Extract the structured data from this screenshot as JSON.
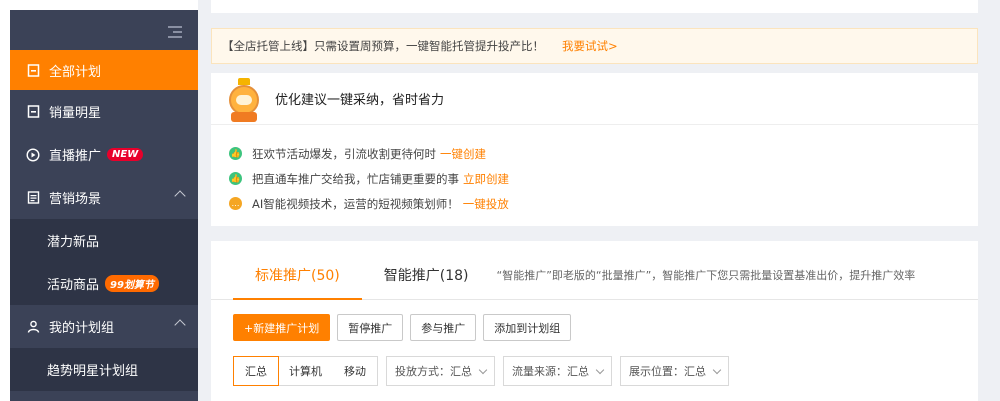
{
  "sidebar": {
    "items": [
      {
        "label": "全部计划",
        "icon": "bookmark-icon",
        "active": true
      },
      {
        "label": "销量明星",
        "icon": "bookmark-icon"
      },
      {
        "label": "直播推广",
        "icon": "play-circle-icon",
        "badge": "NEW"
      },
      {
        "label": "营销场景",
        "icon": "document-icon",
        "expanded": true
      },
      {
        "label": "我的计划组",
        "icon": "user-icon",
        "expanded": true
      }
    ],
    "sub_items": [
      {
        "label": "潜力新品"
      },
      {
        "label": "活动商品",
        "badge": "99划算节"
      },
      {
        "label": "趋势明星计划组"
      }
    ]
  },
  "notice": {
    "text": "【全店托管上线】只需设置周预算，一键智能托管提升投产比！",
    "link": "我要试试>"
  },
  "suggestion": {
    "title": "优化建议一键采纳，省时省力",
    "tips": [
      {
        "text": "狂欢节活动爆发，引流收割更待何时",
        "link": "一键创建",
        "icon": "thumbs-up-icon",
        "color": "#3dc47e"
      },
      {
        "text": "把直通车推广交给我，忙店铺更重要的事",
        "link": "立即创建",
        "icon": "thumbs-up-icon",
        "color": "#3dc47e"
      },
      {
        "text": "AI智能视频技术，运营的短视频策划师！",
        "link": "一键投放",
        "icon": "chat-icon",
        "color": "#f5a623"
      }
    ]
  },
  "tabs": {
    "items": [
      {
        "label": "标准推广(50)",
        "active": true
      },
      {
        "label": "智能推广(18)"
      }
    ],
    "description": "“智能推广”即老版的“批量推广”，智能推广下您只需批量设置基准出价，提升推广效率"
  },
  "actions": {
    "new_plan": "+新建推广计划",
    "pause": "暂停推广",
    "join": "参与推广",
    "add_group": "添加到计划组"
  },
  "filters": {
    "segments": [
      "汇总",
      "计算机",
      "移动"
    ],
    "selected_segment": "汇总",
    "delivery": "投放方式：汇总",
    "traffic": "流量来源：汇总",
    "position": "展示位置：汇总"
  },
  "colors": {
    "accent": "#ff8000",
    "sidebar_bg": "#3b4257",
    "sidebar_sub_bg": "#2e3446",
    "new_badge": "#e8002b"
  }
}
